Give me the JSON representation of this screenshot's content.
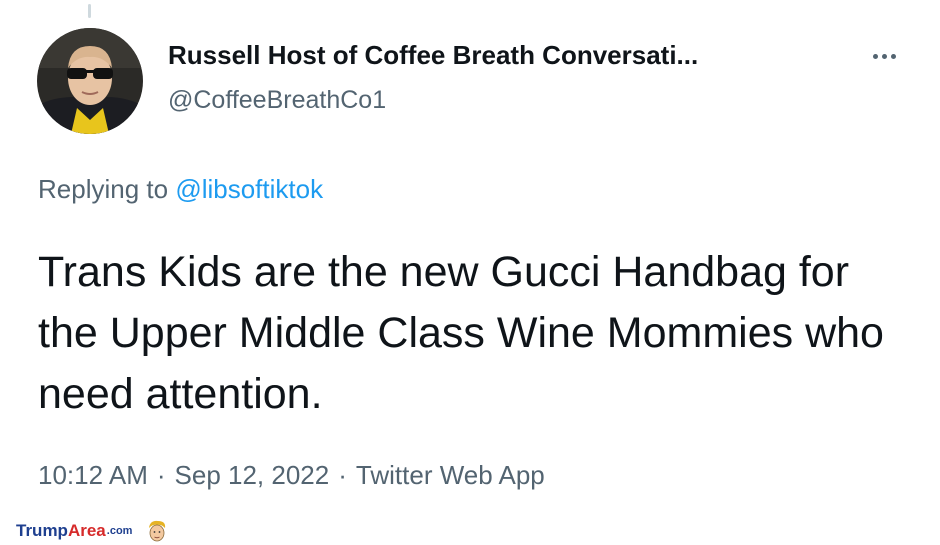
{
  "tweet": {
    "author_name": "Russell Host of Coffee Breath Conversati...",
    "author_handle": "@CoffeeBreathCo1",
    "replying_prefix": "Replying to",
    "replying_to": "@libsoftiktok",
    "text": "Trans Kids are the new Gucci Handbag for the Upper Middle Class Wine Mommies who need attention.",
    "time": "10:12 AM",
    "date": "Sep 12, 2022",
    "source": "Twitter Web App",
    "separator": "·",
    "more_icon": "more-horizontal-icon"
  },
  "watermark": {
    "part1": "Trump",
    "part2": "Area",
    "part3": ".com"
  },
  "colors": {
    "text_primary": "#0f1419",
    "text_secondary": "#536471",
    "link": "#1d9bf0",
    "watermark_blue": "#1e3f8f",
    "watermark_red": "#d62a2a"
  }
}
